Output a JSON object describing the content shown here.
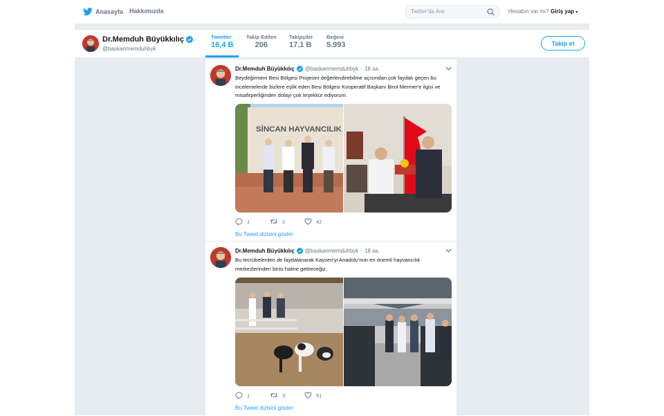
{
  "nav": {
    "home_label": "Anasayfa",
    "about_label": "Hakkımızda"
  },
  "search": {
    "placeholder": "Twitter'da Ara"
  },
  "login": {
    "prompt": "Hesabın var mı?",
    "action": "Giriş yap"
  },
  "profile": {
    "name": "Dr.Memduh Büyükkılıç",
    "handle": "@baskanmemduhbyk",
    "follow_label": "Takip et",
    "stats": [
      {
        "label": "Tweetler",
        "value": "16,4 B"
      },
      {
        "label": "Takip Edilen",
        "value": "206"
      },
      {
        "label": "Takipçiler",
        "value": "17,1 B"
      },
      {
        "label": "Beğeni",
        "value": "5.993"
      }
    ]
  },
  "tweets": [
    {
      "name": "Dr.Memduh Büyükkılıç",
      "handle": "@baskanmemduhbyk",
      "time": "18 sa.",
      "text": "Beydeğirmeni Besi Bölgesi Projesini değerlendirebilme açısından çok faydalı geçen bu incelemelerde bizlere eşlik eden Besi Bölgesi Kooperatif Başkanı Birol Mermer'e ilgisi ve misafirperliğinden dolayı çok teşekkür ediyorum.",
      "sign_text": "SİNCAN HAYVANCILIK",
      "replies": "1",
      "retweets": "2",
      "likes": "42",
      "show_thread": "Bu Tweet dizisini göster"
    },
    {
      "name": "Dr.Memduh Büyükkılıç",
      "handle": "@baskanmemduhbyk",
      "time": "18 sa.",
      "text": "Bu tecrübelerden de faydalanarak Kayseri'yi Anadolu'nun en önemli hayvancılık merkezlerinden birisi haline getireceğiz.",
      "replies": "1",
      "retweets": "3",
      "likes": "51",
      "show_thread": "Bu Tweet dizisini göster"
    }
  ],
  "colors": {
    "accent": "#1da1f2",
    "background": "#e6ecf0",
    "text_secondary": "#657786"
  }
}
